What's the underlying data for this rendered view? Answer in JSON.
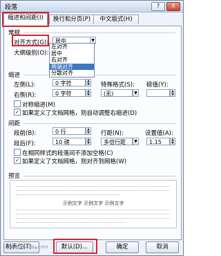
{
  "window": {
    "title": "段落",
    "help_label": "?",
    "close_label": "X"
  },
  "tabs": [
    {
      "label": "缩进和间距(I)"
    },
    {
      "label": "换行和分页(P)"
    },
    {
      "label": "中文版式(H)"
    }
  ],
  "general": {
    "section_label": "常规",
    "alignment_label": "对齐方式(G):",
    "alignment_value": "居中",
    "outline_label": "大纲级别(O):",
    "alignment_options": [
      "左对齐",
      "居中",
      "右对齐",
      "两端对齐",
      "分散对齐"
    ],
    "selected_option_index": 3
  },
  "indent": {
    "section_label": "缩进",
    "left_label": "左侧(L):",
    "left_value": "0 字符",
    "right_label": "右侧(R):",
    "right_value": "0 字符",
    "special_label": "特殊格式(S):",
    "special_value": "(无)",
    "measure_label": "磅值(Y):",
    "mirror_label": "对称缩进(M)",
    "mirror_checked": false,
    "auto_adjust_label": "如果定义了文档网格，则自动调整右缩进(D)",
    "auto_adjust_checked": true
  },
  "spacing": {
    "section_label": "间距",
    "before_label": "段前(B):",
    "before_value": "0 行",
    "after_label": "段后(F):",
    "after_value": "10 磅",
    "line_label": "行距(N):",
    "line_value": "多倍行距",
    "setting_label": "设置值(A):",
    "setting_value": "1.15",
    "no_space_label": "在相同样式的段落间不添加空格(C)",
    "no_space_checked": false,
    "snap_grid_label": "如果定义了文档网格，则对齐到网格(W)",
    "snap_grid_checked": true
  },
  "preview": {
    "section_label": "预览",
    "sample_text": "示例文字 示例文字 示例文字"
  },
  "buttons": {
    "tabs_label": "制表位(T)...",
    "default_label": "默认(D)...",
    "ok_label": "确定",
    "cancel_label": "取消"
  },
  "watermark": "jingyan.baidu.com",
  "colors": {
    "highlight": "#d9232f",
    "selection": "#3a78c4"
  }
}
